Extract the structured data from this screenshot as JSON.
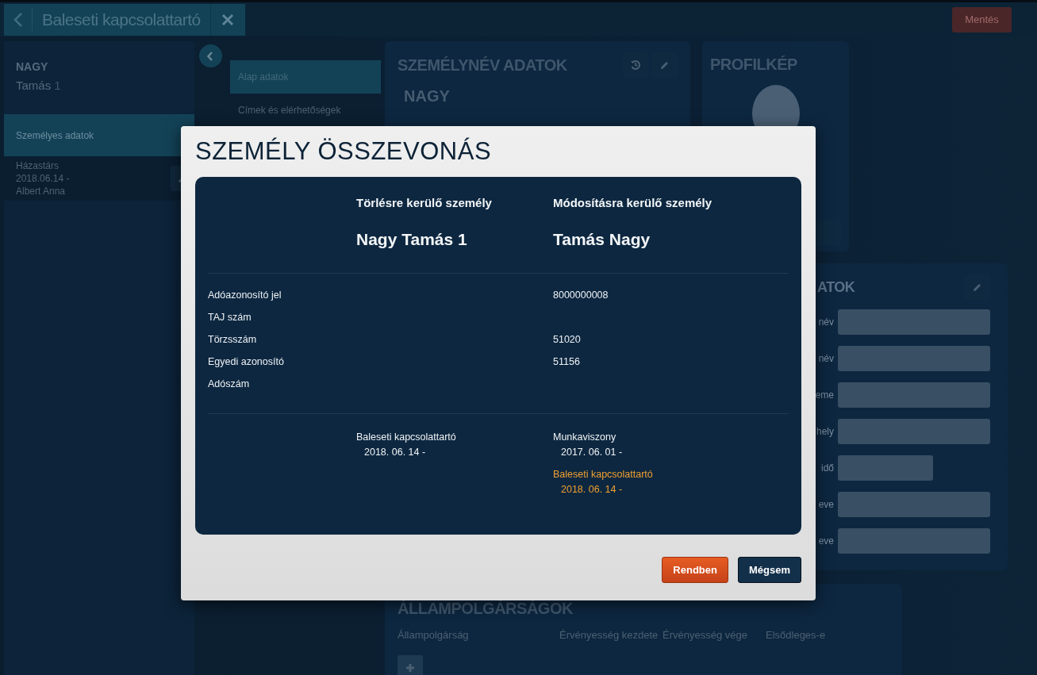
{
  "header": {
    "tab_title": "Baleseti kapcsolattartó",
    "save_button": "Mentés"
  },
  "person": {
    "surname": "NAGY",
    "given_name": "Tamás",
    "suffix": "1"
  },
  "side_menu": [
    {
      "label": "Személyes adatok",
      "selected": true
    }
  ],
  "relations": [
    {
      "type": "Házastárs",
      "date": "2018.06.14 -",
      "name": "Albert Anna"
    }
  ],
  "sub_nav": [
    {
      "label": "Alap adatok",
      "selected": true
    },
    {
      "label": "Címek és elérhetőségek",
      "selected": false
    }
  ],
  "name_card": {
    "title": "SZEMÉLYNÉV ADATOK",
    "surname": "NAGY"
  },
  "profile_card": {
    "title": "PROFILKÉP"
  },
  "details_card": {
    "title": "ATOK",
    "fields": [
      {
        "label": "név",
        "kind": "full"
      },
      {
        "label": "név",
        "kind": "full"
      },
      {
        "label": "eme",
        "kind": "full"
      },
      {
        "label": "hely",
        "kind": "full"
      },
      {
        "label": "idő",
        "kind": "short"
      },
      {
        "label": "eve",
        "kind": "full"
      },
      {
        "label": "eve",
        "kind": "full"
      }
    ]
  },
  "citizenship_card": {
    "title": "ÁLLAMPOLGÁRSÁGOK",
    "columns": [
      "Állampolgárság",
      "Érvényesség kezdete",
      "Érvényesség vége",
      "Elsődleges-e"
    ]
  },
  "dialog": {
    "title": "SZEMÉLY ÖSSZEVONÁS",
    "persons": [
      {
        "heading": "Törlésre kerülő személy",
        "name": "Nagy Tamás 1"
      },
      {
        "heading": "Módosításra kerülő személy",
        "name": "Tamás Nagy"
      }
    ],
    "rows": [
      {
        "label": "Adóazonosító jel",
        "modified": "8000000008"
      },
      {
        "label": "TAJ szám"
      },
      {
        "label": "Törzsszám",
        "modified": "51020"
      },
      {
        "label": "Egyedi azonosító",
        "modified": "51156"
      },
      {
        "label": "Adószám"
      }
    ],
    "deleted_relations": [
      {
        "type": "Baleseti kapcsolattartó",
        "date": "2018. 06. 14 -",
        "highlighted": false
      }
    ],
    "modified_relations": [
      {
        "type": "Munkaviszony",
        "date": "2017. 06. 01 -",
        "highlighted": false
      },
      {
        "type": "Baleseti kapcsolattartó",
        "date": "2018. 06. 14 -",
        "highlighted": true
      }
    ],
    "buttons": [
      {
        "label": "Rendben",
        "kind": "primary"
      },
      {
        "label": "Mégsem",
        "kind": "secondary"
      }
    ]
  }
}
